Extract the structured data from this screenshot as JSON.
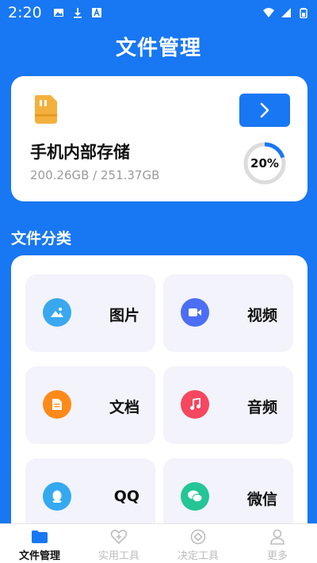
{
  "status_bar": {
    "time": "2:20",
    "icons": [
      "image-icon",
      "download-icon",
      "font-icon",
      "wifi-icon",
      "signal-icon",
      "battery-icon"
    ]
  },
  "header": {
    "title": "文件管理"
  },
  "storage": {
    "title": "手机内部存储",
    "usage": "200.26GB / 251.37GB",
    "percent_label": "20%",
    "percent_value": 20,
    "icon": "sd-card-icon",
    "enter_icon": "chevron-right-icon"
  },
  "categories_section": {
    "title": "文件分类",
    "items": [
      {
        "label": "图片",
        "icon": "image-icon",
        "color": "#3aa8ee"
      },
      {
        "label": "视频",
        "icon": "video-icon",
        "color": "#4c6ef5"
      },
      {
        "label": "文档",
        "icon": "document-icon",
        "color": "#ff8a1a"
      },
      {
        "label": "音频",
        "icon": "music-icon",
        "color": "#f54760"
      },
      {
        "label": "QQ",
        "icon": "qq-icon",
        "color": "#35a9f0"
      },
      {
        "label": "微信",
        "icon": "wechat-icon",
        "color": "#24c596"
      }
    ]
  },
  "bottom_nav": {
    "items": [
      {
        "label": "文件管理",
        "icon": "folder-icon",
        "active": true
      },
      {
        "label": "实用工具",
        "icon": "heart-plus-icon",
        "active": false
      },
      {
        "label": "决定工具",
        "icon": "target-icon",
        "active": false
      },
      {
        "label": "更多",
        "icon": "person-icon",
        "active": false
      }
    ]
  },
  "colors": {
    "primary": "#1877f2",
    "tile_bg": "#f2f3fb",
    "ring_track": "#dcdcdc"
  }
}
